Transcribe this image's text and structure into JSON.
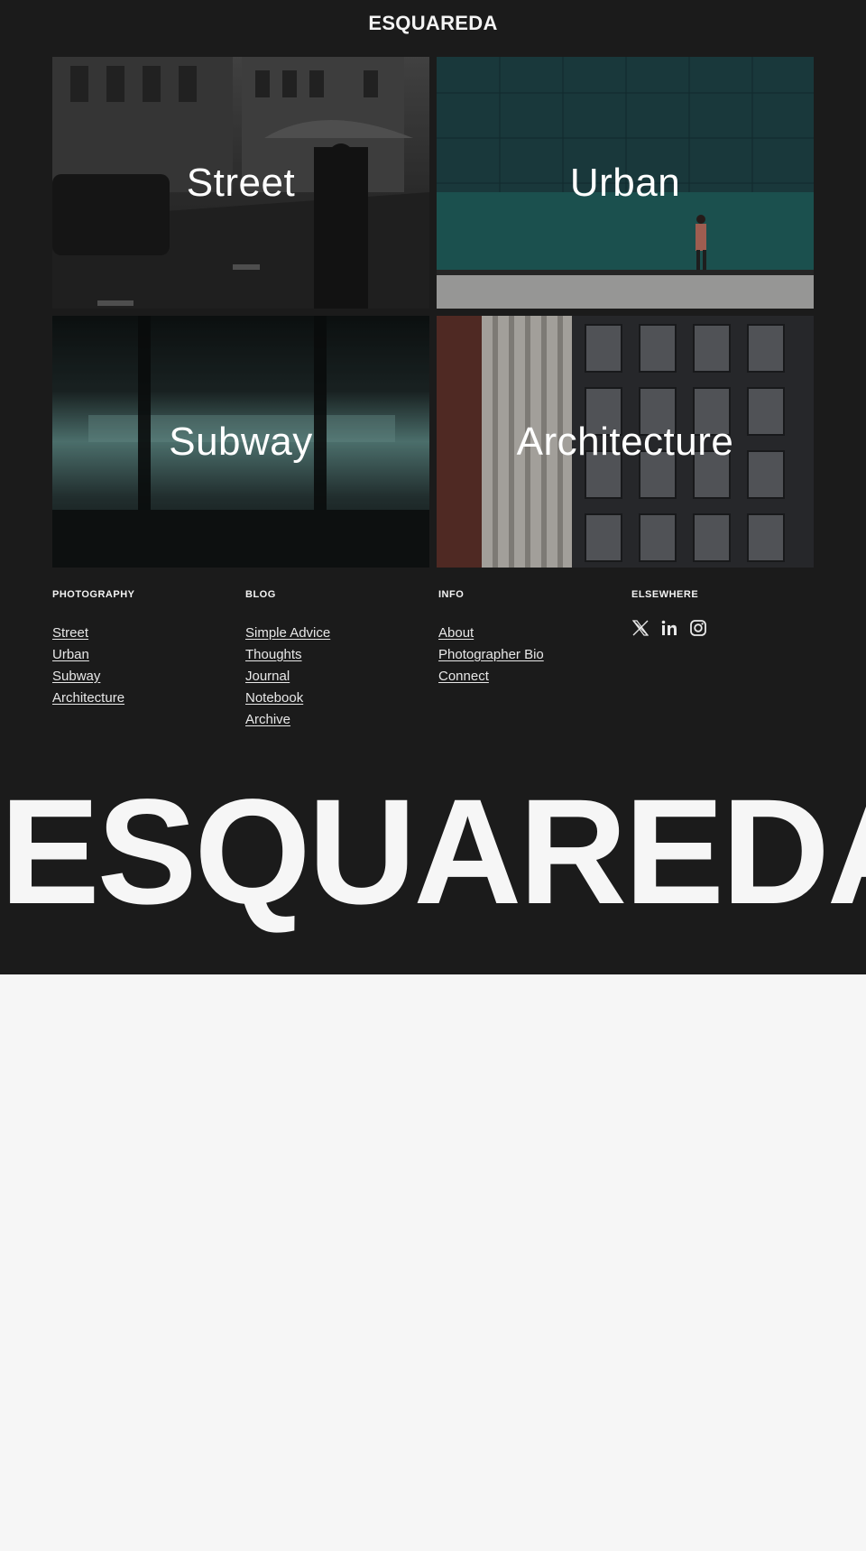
{
  "site": {
    "title": "ESQUAREDA"
  },
  "tiles": [
    {
      "label": "Street"
    },
    {
      "label": "Urban"
    },
    {
      "label": "Subway"
    },
    {
      "label": "Architecture"
    }
  ],
  "footer": {
    "photography": {
      "heading": "PHOTOGRAPHY",
      "links": [
        "Street",
        "Urban",
        "Subway",
        "Architecture"
      ]
    },
    "blog": {
      "heading": "BLOG",
      "links": [
        "Simple Advice",
        "Thoughts",
        "Journal",
        "Notebook",
        "Archive"
      ]
    },
    "info": {
      "heading": "INFO",
      "links": [
        "About",
        "Photographer Bio",
        "Connect"
      ]
    },
    "elsewhere": {
      "heading": "ELSEWHERE",
      "icons": [
        "x-twitter-icon",
        "linkedin-icon",
        "instagram-icon"
      ]
    }
  },
  "big_logo": "ESQUAREDA",
  "colors": {
    "dark_bg": "#1b1b1b",
    "light_bg": "#f6f6f6",
    "text": "#f4f4f4"
  }
}
